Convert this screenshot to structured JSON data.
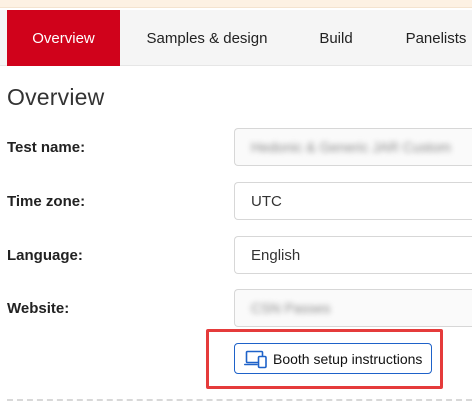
{
  "tabs": [
    {
      "label": "Overview",
      "active": true
    },
    {
      "label": "Samples & design",
      "active": false
    },
    {
      "label": "Build",
      "active": false
    },
    {
      "label": "Panelists",
      "active": false
    }
  ],
  "page": {
    "title": "Overview"
  },
  "fields": {
    "test_name": {
      "label": "Test name:",
      "value": "Hedonic & Generic JAR Custom"
    },
    "time_zone": {
      "label": "Time zone:",
      "value": "UTC"
    },
    "language": {
      "label": "Language:",
      "value": "English"
    },
    "website": {
      "label": "Website:",
      "value": "CSN Passes"
    }
  },
  "booth_button": {
    "label": "Booth setup instructions",
    "icon": "devices-icon"
  },
  "colors": {
    "accent_red": "#d0021b",
    "button_border": "#1e62c9",
    "highlight": "#e53b3b"
  }
}
